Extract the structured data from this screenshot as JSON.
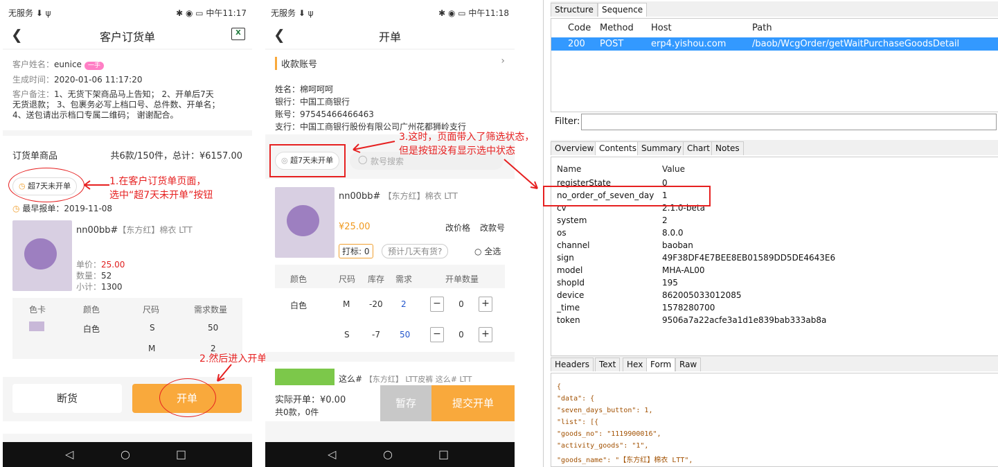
{
  "phone1": {
    "status_left": "无服务 ⬇ ψ",
    "status_right": "✱ ◉ ▭ 中午11:17",
    "title": "客户订货单",
    "customer_name_label": "客户姓名：",
    "customer_name": "eunice",
    "customer_badge": "一手",
    "created_label": "生成时间：",
    "created": "2020-01-06 11:17:20",
    "remark_label": "客户备注：",
    "remark_line1": "1、无货下架商品马上告知； 2、开单后7天",
    "remark_line2": "无货退款； 3、包裹务必写上档口号、总件数、开单名；",
    "remark_line3": "4、送包请出示档口专属二维码； 谢谢配合。",
    "order_goods_label": "订货单商品",
    "order_summary": "共6款/150件，总计：¥6157.00",
    "seven_days_chip": "超7天未开单",
    "earliest_label": "最早报单：2019-11-08",
    "product_name": "nn00bb#",
    "product_sub": "【东方红】棉衣 LTT",
    "unit_price_label": "单价：",
    "unit_price": "25.00",
    "qty_label": "数量：",
    "qty": "52",
    "subtotal_label": "小计：",
    "subtotal": "1300",
    "table_headers": [
      "色卡",
      "颜色",
      "尺码",
      "需求数量"
    ],
    "row1": {
      "color": "白色",
      "size": "S",
      "qty": "50"
    },
    "row2": {
      "size": "M",
      "qty": "2"
    },
    "btn_out": "断货",
    "btn_open": "开单"
  },
  "phone2": {
    "status_left": "无服务 ⬇ ψ",
    "status_right": "✱ ◉ ▭ 中午11:18",
    "title": "开单",
    "account_label": "收款账号",
    "name_line": "姓名：棉呵呵呵",
    "bank_line": "银行：中国工商银行",
    "account_line": "账号：97545466466463",
    "branch_line": "支行：中国工商银行股份有限公司广州花都狮岭支行",
    "seven_days_chip": "超7天未开单",
    "search_placeholder": "款号搜索",
    "product_name": "nn00bb#",
    "product_sub": "【东方红】棉衣 LTT",
    "price": "¥25.00",
    "edit_price": "改价格",
    "edit_no": "改款号",
    "tag_label": "打标: 0",
    "expect_label": "预计几天有货?",
    "select_all": "全选",
    "table_headers": [
      "颜色",
      "尺码",
      "库存",
      "需求",
      "开单数量"
    ],
    "row1": {
      "color": "白色",
      "size": "M",
      "stock": "-20",
      "need": "2",
      "open": "0"
    },
    "row2": {
      "size": "S",
      "stock": "-7",
      "need": "50",
      "open": "0"
    },
    "product2": "这么#",
    "product2_sub": "【东方红】 LTT皮裤 这么# LTT",
    "actual_label": "实际开单：¥0.00",
    "count_label": "共0款，0件",
    "btn_save": "暂存",
    "btn_submit": "提交开单"
  },
  "annotations": {
    "a1_line1": "1.在客户订货单页面，",
    "a1_line2": "选中“超7天未开单”按钮",
    "a2": "2.然后进入开单页面",
    "a3_line1": "3.这时，页面带入了筛选状态，",
    "a3_line2": "但是按钮没有显示选中状态"
  },
  "fiddler": {
    "tabs_top": [
      "Structure",
      "Sequence"
    ],
    "grid_headers": [
      "Code",
      "Method",
      "Host",
      "Path"
    ],
    "grid_row": {
      "code": "200",
      "method": "POST",
      "host": "erp4.yishou.com",
      "path": "/baob/WcgOrder/getWaitPurchaseGoodsDetail"
    },
    "filter_label": "Filter:",
    "tabs_mid": [
      "Overview",
      "Contents",
      "Summary",
      "Chart",
      "Notes"
    ],
    "kv_headers": [
      "Name",
      "Value"
    ],
    "kv": [
      {
        "name": "registerState",
        "value": "0"
      },
      {
        "name": "no_order_of_seven_day",
        "value": "1"
      },
      {
        "name": "cv",
        "value": "2.1.0-beta"
      },
      {
        "name": "system",
        "value": "2"
      },
      {
        "name": "os",
        "value": "8.0.0"
      },
      {
        "name": "channel",
        "value": "baoban"
      },
      {
        "name": "sign",
        "value": "49F38DF4E7BEE8EB01589DD5DE4643E6"
      },
      {
        "name": "model",
        "value": "MHA-AL00"
      },
      {
        "name": "shopId",
        "value": "195"
      },
      {
        "name": "device",
        "value": "862005033012085"
      },
      {
        "name": "_time",
        "value": "1578280700"
      },
      {
        "name": "token",
        "value": "9506a7a22acfe3a1d1e839bab333ab8a"
      }
    ],
    "tabs_bottom": [
      "Headers",
      "Text",
      "Hex",
      "Form",
      "Raw"
    ],
    "json_lines": [
      "{",
      "  \"data\": {",
      "    \"seven_days_button\": 1,",
      "    \"list\": [{",
      "      \"goods_no\": \"1119900016\",",
      "      \"activity_goods\": \"1\",",
      "      \"goods_name\": \"【东方红】棉衣 LTT\","
    ]
  }
}
